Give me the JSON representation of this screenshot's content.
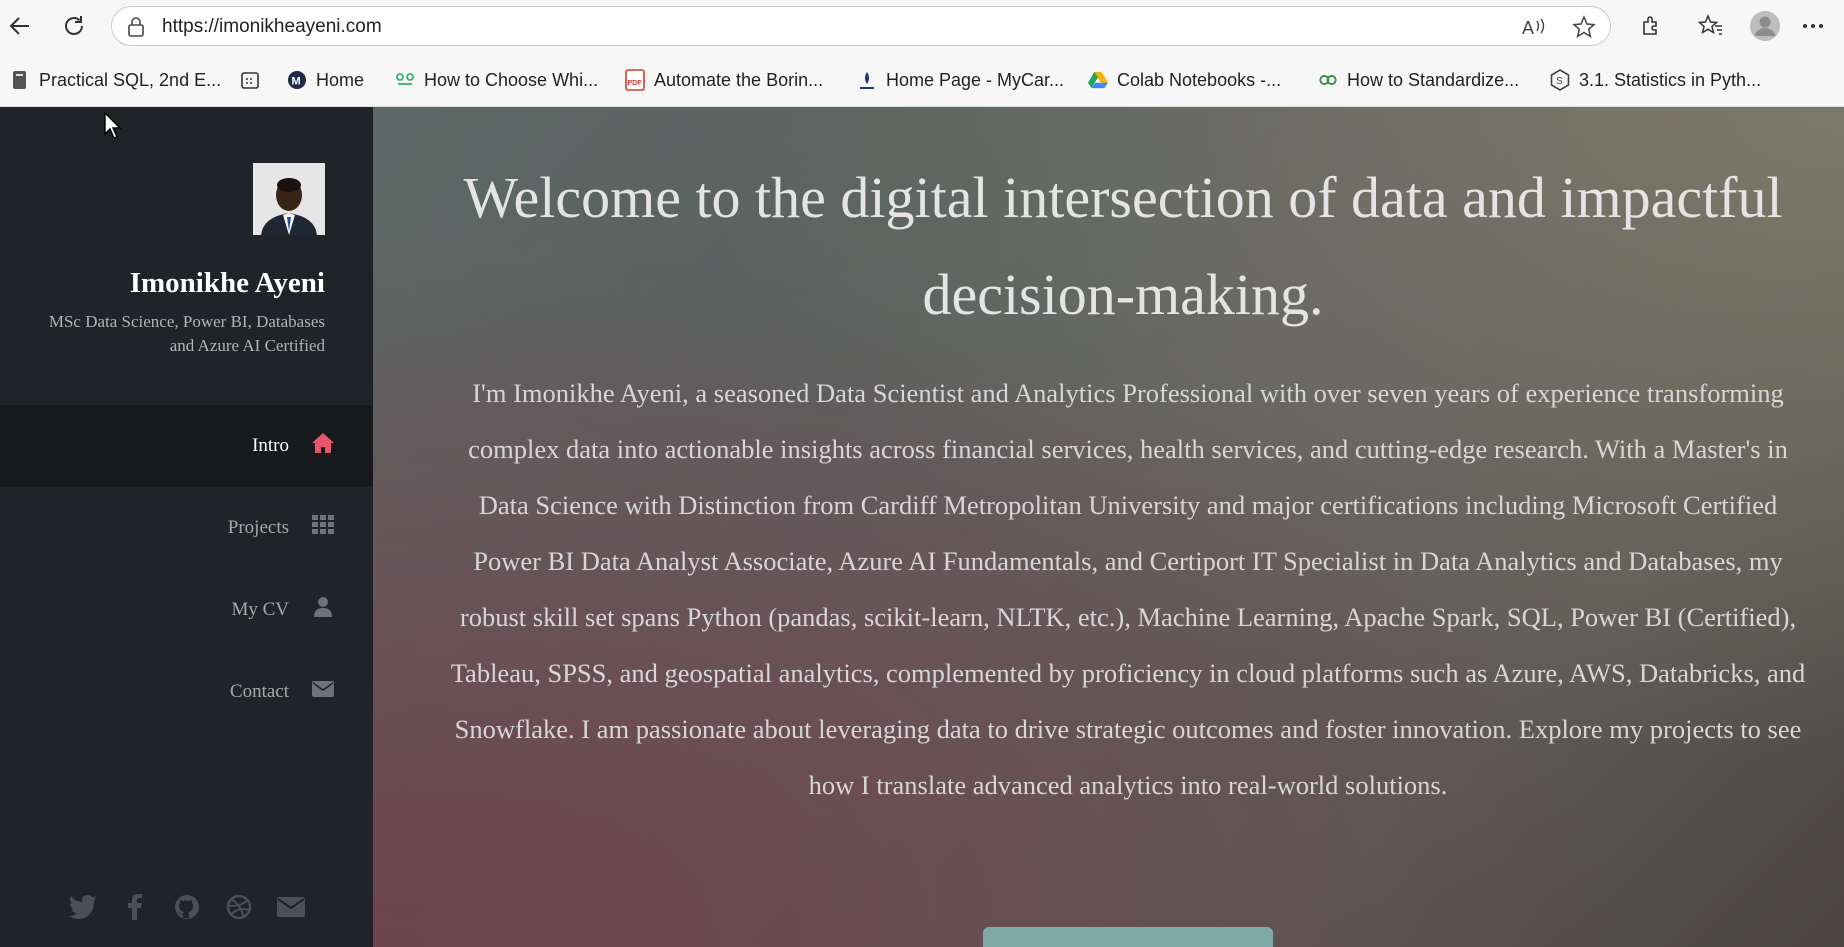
{
  "browser": {
    "url": "https://imonikheayeni.com",
    "bookmarks": [
      {
        "label": "Practical SQL, 2nd E...",
        "icon": "book-icon"
      },
      {
        "label": "",
        "icon": "calendar-icon"
      },
      {
        "label": "Home",
        "icon": "m-logo-icon"
      },
      {
        "label": "How to Choose Whi...",
        "icon": "link-icon"
      },
      {
        "label": "Automate the Borin...",
        "icon": "pdf-icon"
      },
      {
        "label": "Home Page - MyCar...",
        "icon": "site-icon"
      },
      {
        "label": "Colab Notebooks -...",
        "icon": "drive-icon"
      },
      {
        "label": "How to Standardize...",
        "icon": "link-icon"
      },
      {
        "label": "3.1. Statistics in Pyth...",
        "icon": "hex-icon"
      }
    ],
    "pdf_badge": "PDF"
  },
  "sidebar": {
    "name": "Imonikhe Ayeni",
    "tagline": "MSc Data Science, Power BI, Databases and Azure AI Certified",
    "nav": [
      {
        "label": "Intro",
        "icon": "home-icon",
        "active": true
      },
      {
        "label": "Projects",
        "icon": "grid-icon",
        "active": false
      },
      {
        "label": "My CV",
        "icon": "user-icon",
        "active": false
      },
      {
        "label": "Contact",
        "icon": "envelope-icon",
        "active": false
      }
    ],
    "social": [
      "twitter-icon",
      "facebook-icon",
      "github-icon",
      "dribbble-icon",
      "envelope-icon"
    ]
  },
  "main": {
    "headline": "Welcome to the digital intersection of data and impactful decision-making.",
    "intro": "I'm Imonikhe Ayeni, a seasoned Data Scientist and Analytics Professional with over seven years of experience transforming complex data into actionable insights across financial services, health services, and cutting-edge research. With a Master's in Data Science with Distinction from Cardiff Metropolitan University and major certifications including Microsoft Certified Power BI Data Analyst Associate, Azure AI Fundamentals, and Certiport IT Specialist in Data Analytics and Databases, my robust skill set spans Python (pandas, scikit-learn, NLTK, etc.), Machine Learning, Apache Spark, SQL, Power BI (Certified), Tableau, SPSS, and geospatial analytics, complemented by proficiency in cloud platforms such as Azure, AWS, Databricks, and Snowflake. I am passionate about leveraging data to drive strategic outcomes and foster innovation. Explore my projects to see how I translate advanced analytics into real-world solutions."
  },
  "colors": {
    "sidebar_bg": "#202327",
    "active_nav_bg": "#17191c",
    "home_icon_accent": "#e8566e",
    "cta_color": "#7fa9a6"
  }
}
